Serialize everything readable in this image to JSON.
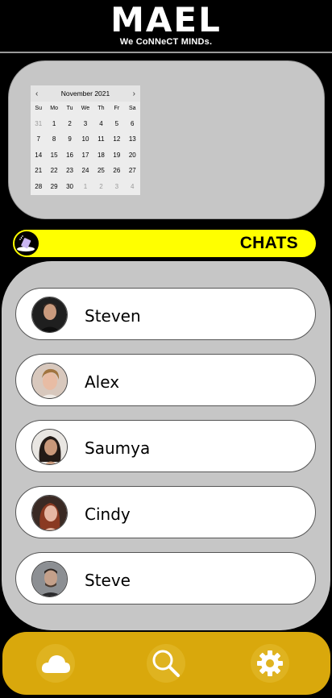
{
  "header": {
    "logo": "MAEL",
    "tagline": "We CoNNeCT MINDs."
  },
  "calendar": {
    "month_label": "November 2021",
    "weekdays": [
      "Su",
      "Mo",
      "Tu",
      "We",
      "Th",
      "Fr",
      "Sa"
    ],
    "weeks": [
      [
        "31",
        "1",
        "2",
        "3",
        "4",
        "5",
        "6"
      ],
      [
        "7",
        "8",
        "9",
        "10",
        "11",
        "12",
        "13"
      ],
      [
        "14",
        "15",
        "16",
        "17",
        "18",
        "19",
        "20"
      ],
      [
        "21",
        "22",
        "23",
        "24",
        "25",
        "26",
        "27"
      ],
      [
        "28",
        "29",
        "30",
        "1",
        "2",
        "3",
        "4"
      ]
    ]
  },
  "chats": {
    "title": "CHATS",
    "items": [
      {
        "name": "Steven",
        "avatar": "avatar-photo-icon"
      },
      {
        "name": "Alex",
        "avatar": "avatar-photo-icon"
      },
      {
        "name": "Saumya",
        "avatar": "avatar-photo-icon"
      },
      {
        "name": "Cindy",
        "avatar": "avatar-photo-icon"
      },
      {
        "name": "Steve",
        "avatar": "avatar-photo-icon"
      }
    ]
  },
  "bottom_nav": {
    "items": [
      {
        "icon": "cloud-icon"
      },
      {
        "icon": "search-icon"
      },
      {
        "icon": "gear-icon"
      }
    ]
  },
  "colors": {
    "accent": "#ffff00",
    "nav": "#d9a80c",
    "panel": "#c6c6c6"
  }
}
